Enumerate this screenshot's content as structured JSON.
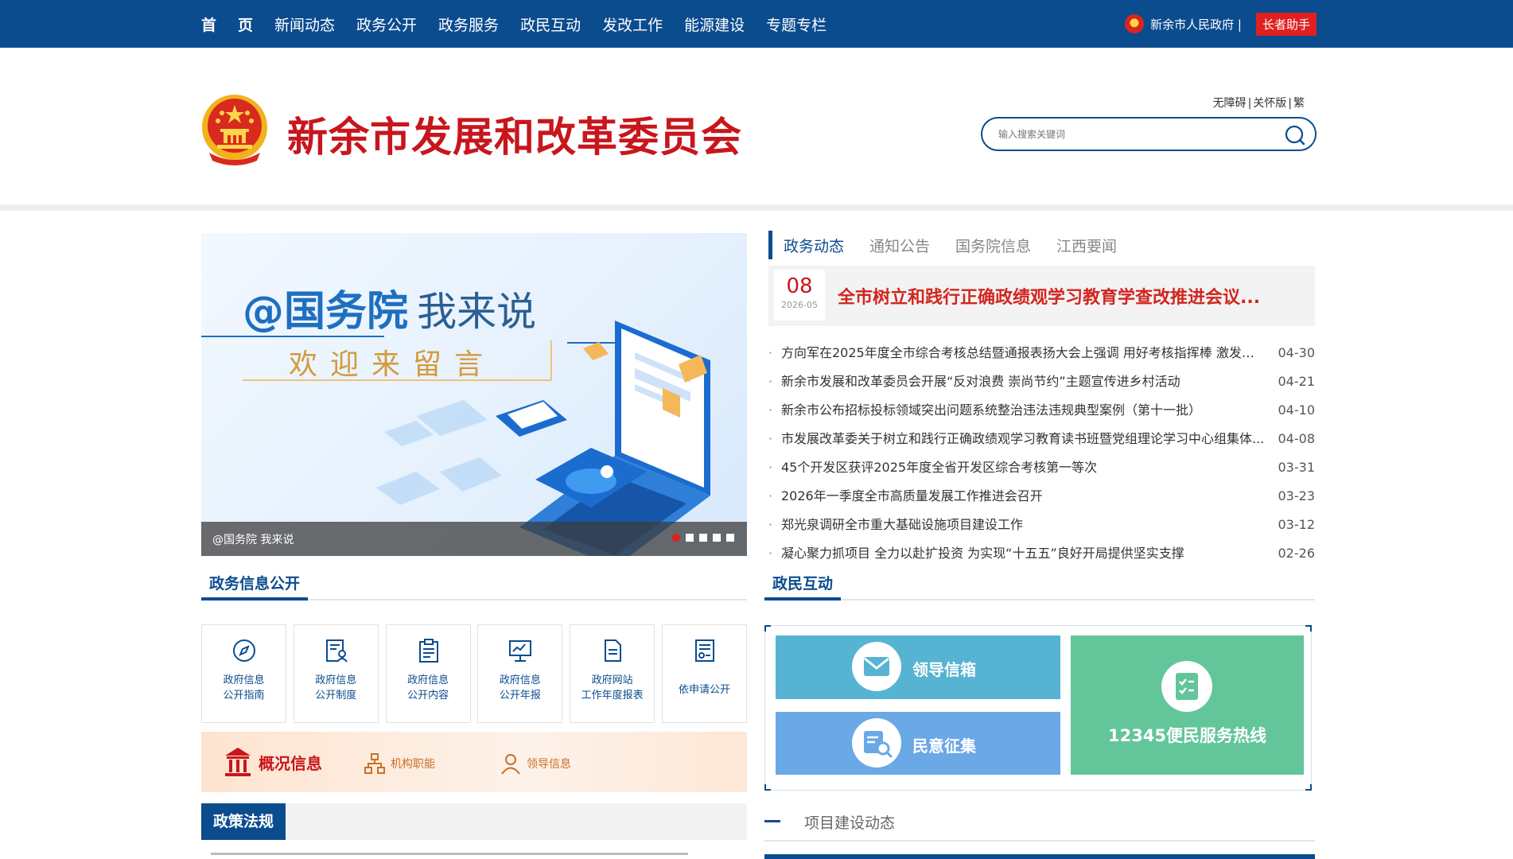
{
  "nav": {
    "items": [
      {
        "label": "首页"
      },
      {
        "label": "新闻动态"
      },
      {
        "label": "政务公开"
      },
      {
        "label": "政务服务"
      },
      {
        "label": "政民互动"
      },
      {
        "label": "发改工作"
      },
      {
        "label": "能源建设"
      },
      {
        "label": "专题专栏"
      }
    ],
    "gov_link": "新余市人民政府 |",
    "elder_button": "长者助手"
  },
  "header": {
    "site_title": "新余市发展和改革委员会",
    "access_links": [
      "无障碍",
      "关怀版",
      "繁"
    ],
    "search_placeholder": "输入搜索关键词"
  },
  "banner": {
    "headline_main": "@国务院",
    "headline_sub": "我来说",
    "invite_text": "欢迎来留言",
    "caption": "@国务院 我来说",
    "slide_count": 5,
    "active_slide": 1
  },
  "news": {
    "tabs": [
      {
        "label": "政务动态",
        "active": true
      },
      {
        "label": "通知公告",
        "active": false
      },
      {
        "label": "国务院信息",
        "active": false
      },
      {
        "label": "江西要闻",
        "active": false
      }
    ],
    "headline": {
      "day": "08",
      "year_month": "2026-05",
      "title": "全市树立和践行正确政绩观学习教育学查改推进会议..."
    },
    "items": [
      {
        "title": "方向军在2025年度全市综合考核总结暨通报表扬大会上强调 用好考核指挥棒 激发实...",
        "date": "04-30"
      },
      {
        "title": "新余市发展和改革委员会开展“反对浪费 崇尚节约”主题宣传进乡村活动",
        "date": "04-21"
      },
      {
        "title": "新余市公布招标投标领域突出问题系统整治违法违规典型案例（第十一批）",
        "date": "04-10"
      },
      {
        "title": "市发展改革委关于树立和践行正确政绩观学习教育读书班暨党组理论学习中心组集体...",
        "date": "04-08"
      },
      {
        "title": "45个开发区获评2025年度全省开发区综合考核第一等次",
        "date": "03-31"
      },
      {
        "title": "2026年一季度全市高质量发展工作推进会召开",
        "date": "03-23"
      },
      {
        "title": "郑光泉调研全市重大基础设施项目建设工作",
        "date": "03-12"
      },
      {
        "title": "凝心聚力抓项目 全力以赴扩投资 为实现“十五五”良好开局提供坚实支撑",
        "date": "02-26"
      }
    ]
  },
  "info_section": {
    "title": "政务信息公开",
    "cards": [
      {
        "line1": "政府信息",
        "line2": "公开指南",
        "icon": "compass-icon"
      },
      {
        "line1": "政府信息",
        "line2": "公开制度",
        "icon": "document-user-icon"
      },
      {
        "line1": "政府信息",
        "line2": "公开内容",
        "icon": "clipboard-icon"
      },
      {
        "line1": "政府信息",
        "line2": "公开年报",
        "icon": "report-chart-icon"
      },
      {
        "line1": "政府网站",
        "line2": "工作年度报表",
        "icon": "file-icon"
      },
      {
        "line1": "依申请公开",
        "line2": "",
        "icon": "application-form-icon"
      }
    ],
    "overview": {
      "main": "概况信息",
      "org": "机构职能",
      "leader": "领导信息"
    }
  },
  "policy_section": {
    "title": "政策法规"
  },
  "interaction_section": {
    "title": "政民互动",
    "mailbox": "领导信箱",
    "opinion": "民意征集",
    "hotline": "12345便民服务热线"
  },
  "project_section": {
    "title": "项目建设动态"
  },
  "colors": {
    "primary_blue": "#0b4c8f",
    "title_red": "#c8161d",
    "mail_tile": "#57b3d2",
    "opinion_tile": "#6aa8e6",
    "hotline_tile": "#63c59a"
  }
}
